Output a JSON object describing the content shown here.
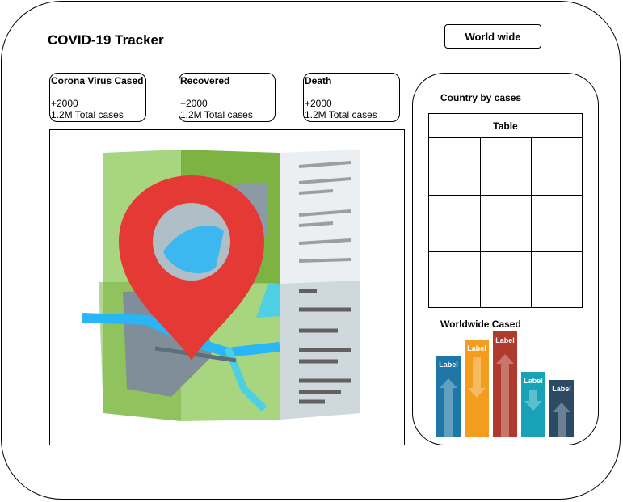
{
  "app": {
    "title": "COVID-19 Tracker",
    "world_button": "World wide"
  },
  "stats": [
    {
      "label": "Corona Virus Cased",
      "delta": "+2000",
      "total": "1.2M Total cases"
    },
    {
      "label": "Recovered",
      "delta": "+2000",
      "total": "1.2M Total cases"
    },
    {
      "label": "Death",
      "delta": "+2000",
      "total": "1.2M Total cases"
    }
  ],
  "map": {
    "icon": "map-pin-icon",
    "pin_color": "#e53935",
    "land_color": "#8bc34a"
  },
  "sidebar": {
    "country_title": "Country by cases",
    "table_header": "Table",
    "chart_title": "Worldwide Cased"
  },
  "chart_data": {
    "type": "bar",
    "categories": [
      "Label",
      "Label",
      "Label",
      "Label",
      "Label"
    ],
    "values": [
      100,
      120,
      130,
      80,
      70
    ],
    "colors": [
      "#1f77a8",
      "#f39c1e",
      "#b03a2e",
      "#17a2b8",
      "#2c4a63"
    ],
    "arrows": [
      "up",
      "down",
      "up",
      "down",
      "up"
    ],
    "grid": false
  }
}
